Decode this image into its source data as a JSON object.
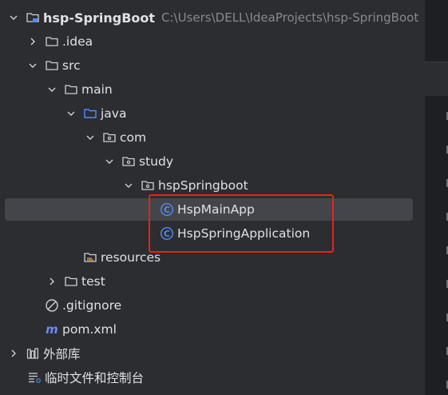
{
  "project_root": {
    "name": "hsp-SpringBoot",
    "path": "C:\\Users\\DELL\\IdeaProjects\\hsp-SpringBoot"
  },
  "tree": {
    "idea": ".idea",
    "src": "src",
    "main": "main",
    "java": "java",
    "com": "com",
    "study": "study",
    "package": "hspSpringboot",
    "class_main": "HspMainApp",
    "class_app": "HspSpringApplication",
    "resources": "resources",
    "test": "test",
    "gitignore": ".gitignore",
    "pom": "pom.xml",
    "external_libs": "外部库",
    "scratches": "临时文件和控制台"
  },
  "icons": {
    "chevron_expanded": "chevron-down-icon",
    "chevron_collapsed": "chevron-right-icon",
    "folder": "folder-icon",
    "source_folder": "source-folder-icon",
    "package": "package-icon",
    "class": "class-icon",
    "resources_folder": "resources-folder-icon",
    "gitignore": "gitignore-icon",
    "maven": "maven-icon",
    "libraries": "libraries-icon",
    "scratches": "scratches-icon",
    "project_module": "module-icon"
  },
  "colors": {
    "panel_background": "#2b2d30",
    "selected_row": "#43454a",
    "text": "#dfe1e5",
    "path_text": "#868a91",
    "class_icon": "#548af7",
    "highlight_box": "#e5231d"
  },
  "selection": {
    "selected_item": "HspMainApp",
    "highlighted_items": [
      "HspMainApp",
      "HspSpringApplication"
    ]
  }
}
